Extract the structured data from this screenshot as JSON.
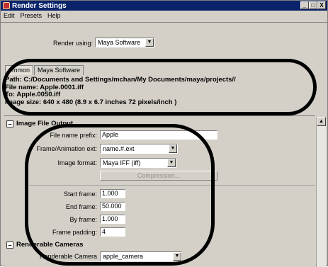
{
  "window": {
    "title": "Render Settings",
    "controls": {
      "minimize": "_",
      "maximize": "□",
      "close": "X"
    }
  },
  "menu": [
    "Edit",
    "Presets",
    "Help"
  ],
  "render_using": {
    "label": "Render using:",
    "value": "Maya Software"
  },
  "tabs": [
    "ommon",
    "Maya Software"
  ],
  "info": {
    "path": "Path: C:/Documents and Settings/mchan/My Documents/maya/projects//",
    "file_name": "File name:  Apple.0001.iff",
    "to": "To:             Apple.0050.iff",
    "image_size": "Image size: 640 x 480 (8.9 x 6.7 inches 72 pixels/inch )"
  },
  "image_file_output": {
    "header": "Image File Output",
    "file_name_prefix_label": "File name prefix:",
    "file_name_prefix": "Apple",
    "frame_ext_label": "Frame/Animation ext:",
    "frame_ext": "name.#.ext",
    "image_format_label": "Image format:",
    "image_format": "Maya IFF (iff)",
    "compression_label": "Compression...",
    "start_frame_label": "Start frame:",
    "start_frame": "1.000",
    "end_frame_label": "End frame:",
    "end_frame": "50.000",
    "by_frame_label": "By frame:",
    "by_frame": "1.000",
    "frame_padding_label": "Frame padding:",
    "frame_padding": "4"
  },
  "renderable_cameras": {
    "header": "Renderable Cameras",
    "camera_label": "Renderable Camera",
    "camera": "apple_camera"
  },
  "colors": {
    "titlebar": "#0a246a",
    "window_bg": "#d4d0c8",
    "annotation": "#000000"
  }
}
